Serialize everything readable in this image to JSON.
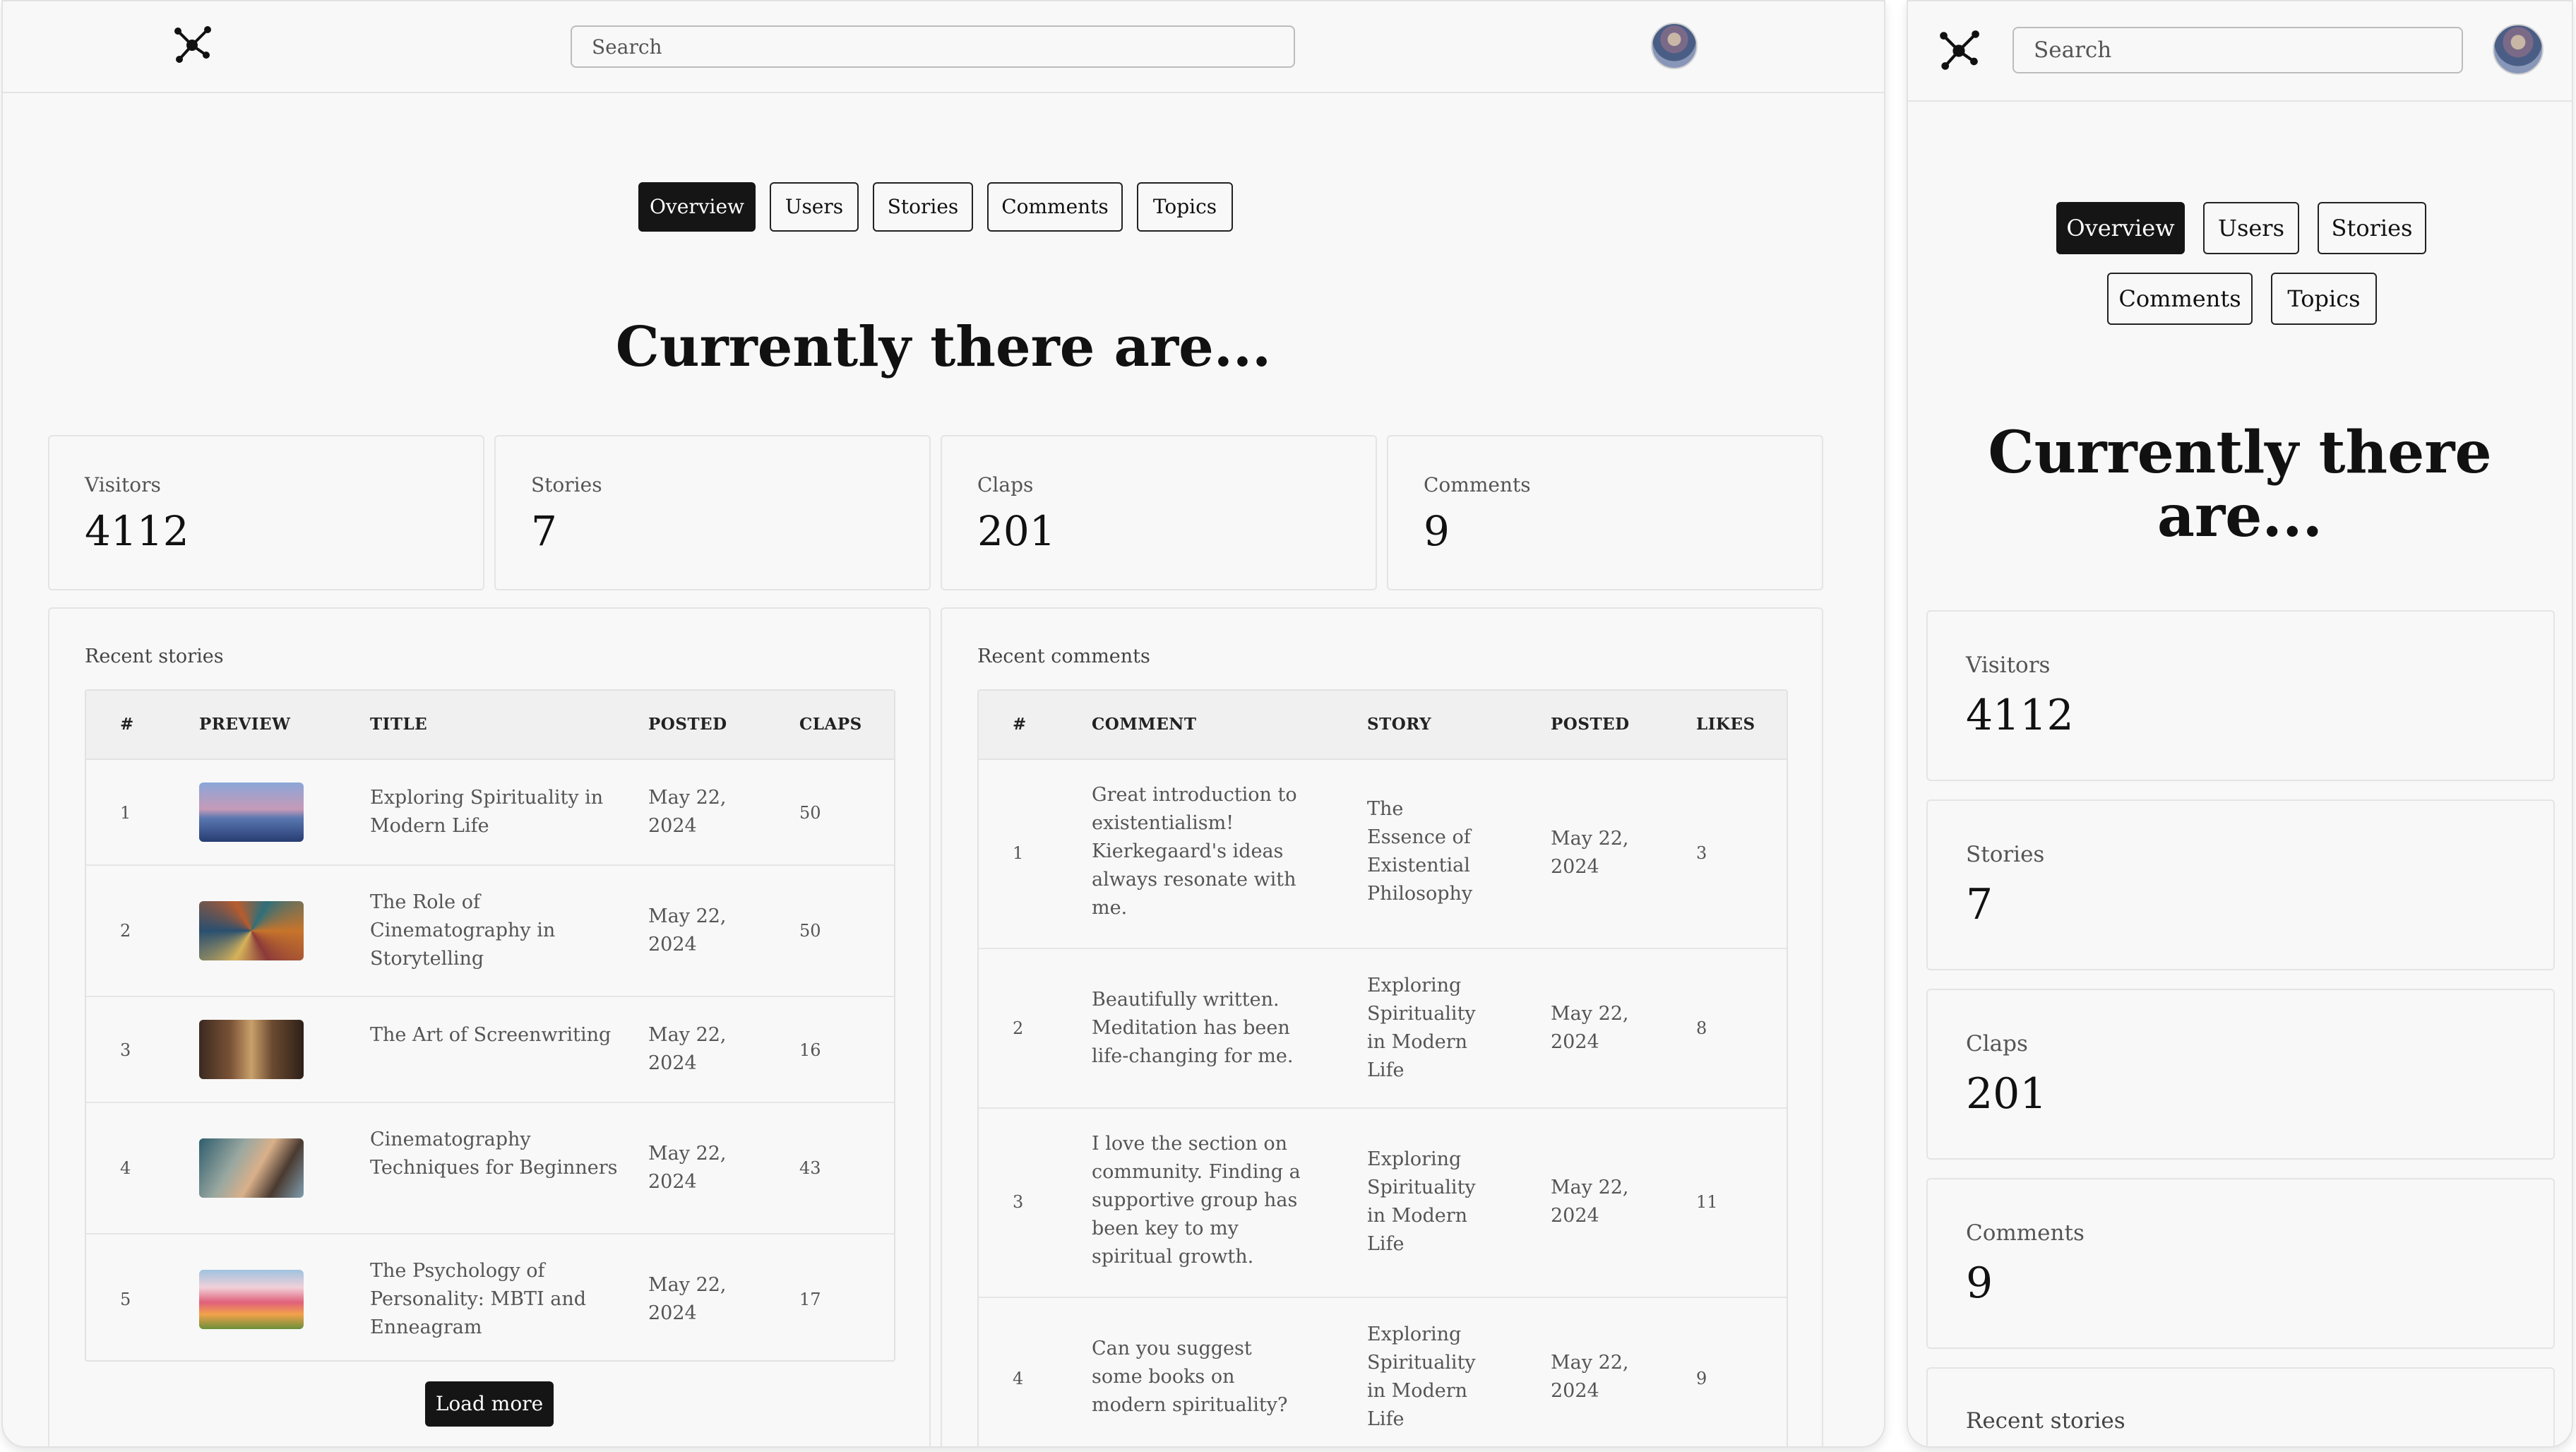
{
  "search_placeholder": "Search",
  "tabs": [
    "Overview",
    "Users",
    "Stories",
    "Comments",
    "Topics"
  ],
  "headline": "Currently there are...",
  "stats": [
    {
      "label": "Visitors",
      "value": "4112"
    },
    {
      "label": "Stories",
      "value": "7"
    },
    {
      "label": "Claps",
      "value": "201"
    },
    {
      "label": "Comments",
      "value": "9"
    }
  ],
  "recent_stories": {
    "title": "Recent stories",
    "columns": [
      "#",
      "PREVIEW",
      "TITLE",
      "POSTED",
      "CLAPS"
    ],
    "rows": [
      {
        "num": "1",
        "title": "Exploring Spirituality in Modern Life",
        "posted": "May 22, 2024",
        "claps": "50",
        "thumb": "meditation-lake-image"
      },
      {
        "num": "2",
        "title": "The Role of Cinematography in Storytelling",
        "posted": "May 22, 2024",
        "claps": "50",
        "thumb": "mosaic-art-image"
      },
      {
        "num": "3",
        "title": "The Art of Screenwriting",
        "posted": "May 22, 2024",
        "claps": "16",
        "thumb": "library-room-image"
      },
      {
        "num": "4",
        "title": "Cinematography Techniques for Beginners",
        "posted": "May 22, 2024",
        "claps": "43",
        "thumb": "camera-person-image"
      },
      {
        "num": "5",
        "title": "The Psychology of Personality: MBTI and Enneagram",
        "posted": "May 22, 2024",
        "claps": "17",
        "thumb": "flower-field-image"
      }
    ],
    "load_more": "Load more"
  },
  "recent_comments": {
    "title": "Recent comments",
    "columns": [
      "#",
      "COMMENT",
      "STORY",
      "POSTED",
      "LIKES"
    ],
    "rows": [
      {
        "num": "1",
        "comment": "Great introduction to existentialism! Kierkegaard's ideas always resonate with me.",
        "story": "The Essence of Existential Philosophy",
        "posted": "May 22, 2024",
        "likes": "3"
      },
      {
        "num": "2",
        "comment": "Beautifully written. Meditation has been life-changing for me.",
        "story": "Exploring Spirituality in Modern Life",
        "posted": "May 22, 2024",
        "likes": "8"
      },
      {
        "num": "3",
        "comment": "I love the section on community. Finding a supportive group has been key to my spiritual growth.",
        "story": "Exploring Spirituality in Modern Life",
        "posted": "May 22, 2024",
        "likes": "11"
      },
      {
        "num": "4",
        "comment": "Can you suggest some books on modern spirituality?",
        "story": "Exploring Spirituality in Modern Life",
        "posted": "May 22, 2024",
        "likes": "9"
      }
    ]
  },
  "mobile": {
    "headline_line1": "Currently there",
    "headline_line2": "are...",
    "recent_stories_title": "Recent stories"
  }
}
